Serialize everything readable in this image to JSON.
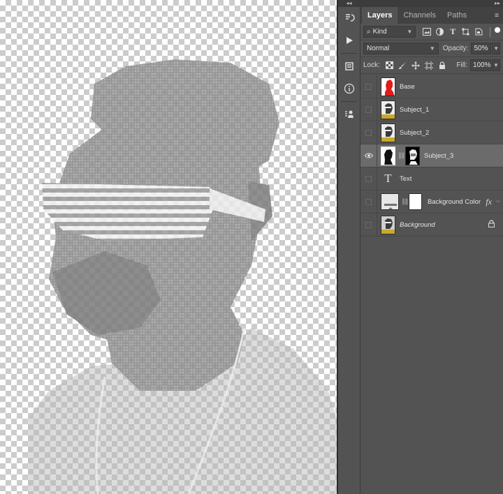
{
  "tool_strip": {
    "collapse_glyph": "◂◂",
    "icons": [
      "history-brush-icon",
      "play-action-icon",
      "properties-icon",
      "info-icon",
      "clone-source-icon"
    ]
  },
  "panel": {
    "expand_glyph": "▸▸",
    "tabs": [
      {
        "label": "Layers",
        "active": true
      },
      {
        "label": "Channels",
        "active": false
      },
      {
        "label": "Paths",
        "active": false
      }
    ],
    "filter": {
      "kind_label": "Kind"
    },
    "blend_mode": "Normal",
    "opacity_label": "Opacity:",
    "opacity_value": "50%",
    "lock_label": "Lock:",
    "fill_label": "Fill:",
    "fill_value": "100%"
  },
  "layers": [
    {
      "name": "Base",
      "visible": false,
      "selected": false,
      "thumb": "red-silhouette"
    },
    {
      "name": "Subject_1",
      "visible": false,
      "selected": false,
      "thumb": "portrait"
    },
    {
      "name": "Subject_2",
      "visible": false,
      "selected": false,
      "thumb": "portrait"
    },
    {
      "name": "Subject_3",
      "visible": true,
      "selected": true,
      "thumb": "mask-pair"
    },
    {
      "name": "Text",
      "visible": false,
      "selected": false,
      "thumb": "type"
    },
    {
      "name": "Background Color",
      "visible": false,
      "selected": false,
      "thumb": "fill-pair",
      "fx": "fx"
    },
    {
      "name": "Background",
      "visible": false,
      "selected": false,
      "thumb": "portrait",
      "locked": true
    }
  ],
  "colors": {
    "panel_bg": "#535353",
    "selected_row": "#6b6b6b",
    "base_thumb_red": "#e11b1b",
    "shirt_yellow": "#c9a92b"
  }
}
